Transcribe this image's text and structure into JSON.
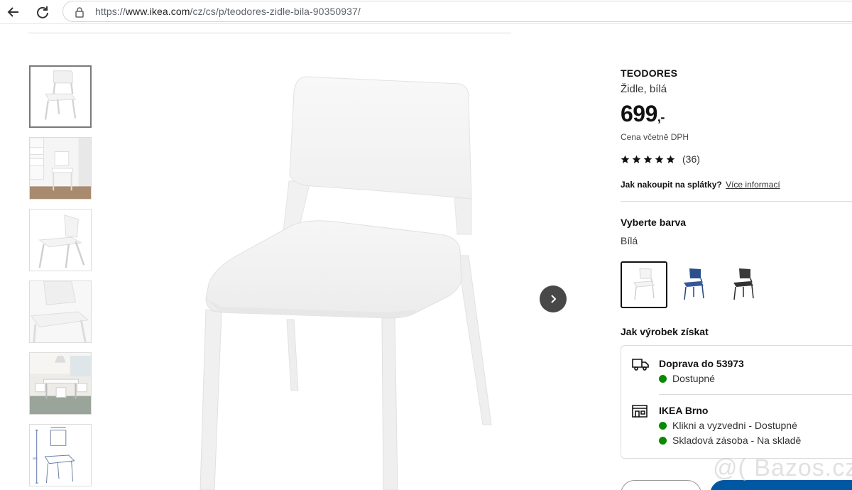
{
  "browser": {
    "url_prefix": "https://",
    "url_domain": "www.ikea.com",
    "url_path": "/cz/cs/p/teodores-zidle-bila-90350937/"
  },
  "product": {
    "name": "TEODORES",
    "description": "Židle, bílá",
    "price": "699",
    "price_suffix": ",-",
    "vat_note": "Cena včetně DPH",
    "rating": 5,
    "review_count": "(36)",
    "installment_label": "Jak nakoupit na splátky?",
    "installment_link": "Více informací"
  },
  "color_select": {
    "heading": "Vyberte barva",
    "selected": "Bílá",
    "options": [
      {
        "name": "white",
        "color": "#f2f2f2"
      },
      {
        "name": "blue",
        "color": "#2b4f8c"
      },
      {
        "name": "black",
        "color": "#2e2e2e"
      }
    ]
  },
  "availability": {
    "heading": "Jak výrobek získat",
    "delivery": {
      "title": "Doprava do 53973",
      "status": "Dostupné"
    },
    "store": {
      "title": "IKEA Brno",
      "line1": "Klikni a vyzvedni - Dostupné",
      "line2": "Skladová zásoba - Na skladě"
    }
  },
  "watermark": "@( Bazos.cz",
  "colors": {
    "status_green": "#0a8a00",
    "ikea_blue": "#0058a3",
    "nav_button": "#484848"
  }
}
